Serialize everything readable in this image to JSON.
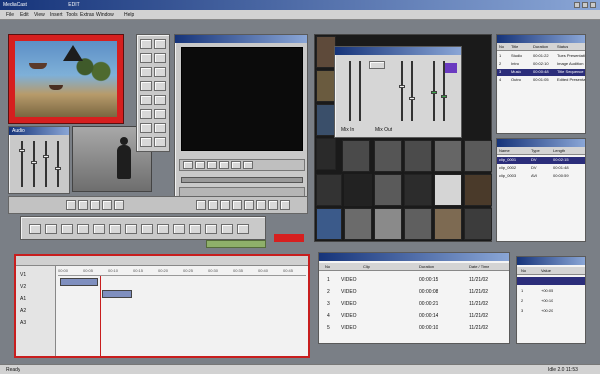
{
  "app": {
    "title": "MediaCast",
    "caption": "EDIT",
    "menu": [
      "File",
      "Edit",
      "View",
      "Insert",
      "Tools",
      "Extras",
      "Window",
      "Help"
    ],
    "window_controls": [
      "_",
      "□",
      "×"
    ]
  },
  "mixer": {
    "tabs": [
      "Audio",
      "Video",
      "Record"
    ],
    "bottom_labels": [
      "Mix In",
      "Mix Out"
    ]
  },
  "clip_list": {
    "headers": [
      "No",
      "Title",
      "Duration",
      "Status"
    ],
    "rows": [
      {
        "no": "1",
        "title": "Studio",
        "dur": "00:01:22",
        "status": "Tues Presentation"
      },
      {
        "no": "2",
        "title": "Intro",
        "dur": "00:02:10",
        "status": "Image Audition"
      },
      {
        "no": "3",
        "title": "Music",
        "dur": "00:00:48",
        "status": "Title Sequence"
      },
      {
        "no": "4",
        "title": "Outro",
        "dur": "00:01:05",
        "status": "Edited Presentation"
      }
    ]
  },
  "media_list": {
    "headers": [
      "Name",
      "Type",
      "Length"
    ],
    "rows": [
      {
        "name": "clip_0001",
        "type": "DV",
        "len": "00:02:15"
      },
      {
        "name": "clip_0002",
        "type": "DV",
        "len": "00:01:48"
      },
      {
        "name": "clip_0003",
        "type": "AVI",
        "len": "00:00:59"
      }
    ]
  },
  "playlist": {
    "headers": [
      "No",
      "Clip",
      "Duration",
      "Date / Time"
    ],
    "rows": [
      {
        "no": "1",
        "clip": "VIDEO",
        "dur": "00:00:15",
        "date": "11/21/02"
      },
      {
        "no": "2",
        "clip": "VIDEO",
        "dur": "00:00:08",
        "date": "11/21/02"
      },
      {
        "no": "3",
        "clip": "VIDEO",
        "dur": "00:00:21",
        "date": "11/21/02"
      },
      {
        "no": "4",
        "clip": "VIDEO",
        "dur": "00:00:14",
        "date": "11/21/02"
      },
      {
        "no": "5",
        "clip": "VIDEO",
        "dur": "00:00:10",
        "date": "11/21/02"
      }
    ]
  },
  "small_list": {
    "headers": [
      "No",
      "Value"
    ],
    "rows": [
      {
        "no": "1",
        "value": "+00:05"
      },
      {
        "no": "2",
        "value": "+00:10"
      },
      {
        "no": "3",
        "value": "+00:20"
      }
    ]
  },
  "timeline": {
    "tracks": [
      "V1",
      "V2",
      "A1",
      "A2",
      "A3"
    ],
    "ruler": [
      "00:00",
      "00:05",
      "00:10",
      "00:15",
      "00:20",
      "00:25",
      "00:30",
      "00:35",
      "00:40",
      "00:45"
    ]
  },
  "status": {
    "left": "Ready",
    "right": "Idle  2.0  11:53"
  },
  "colors": {
    "accent_red": "#d61f1f",
    "selection": "#2b2d7a",
    "title_bar": "#16347a"
  }
}
